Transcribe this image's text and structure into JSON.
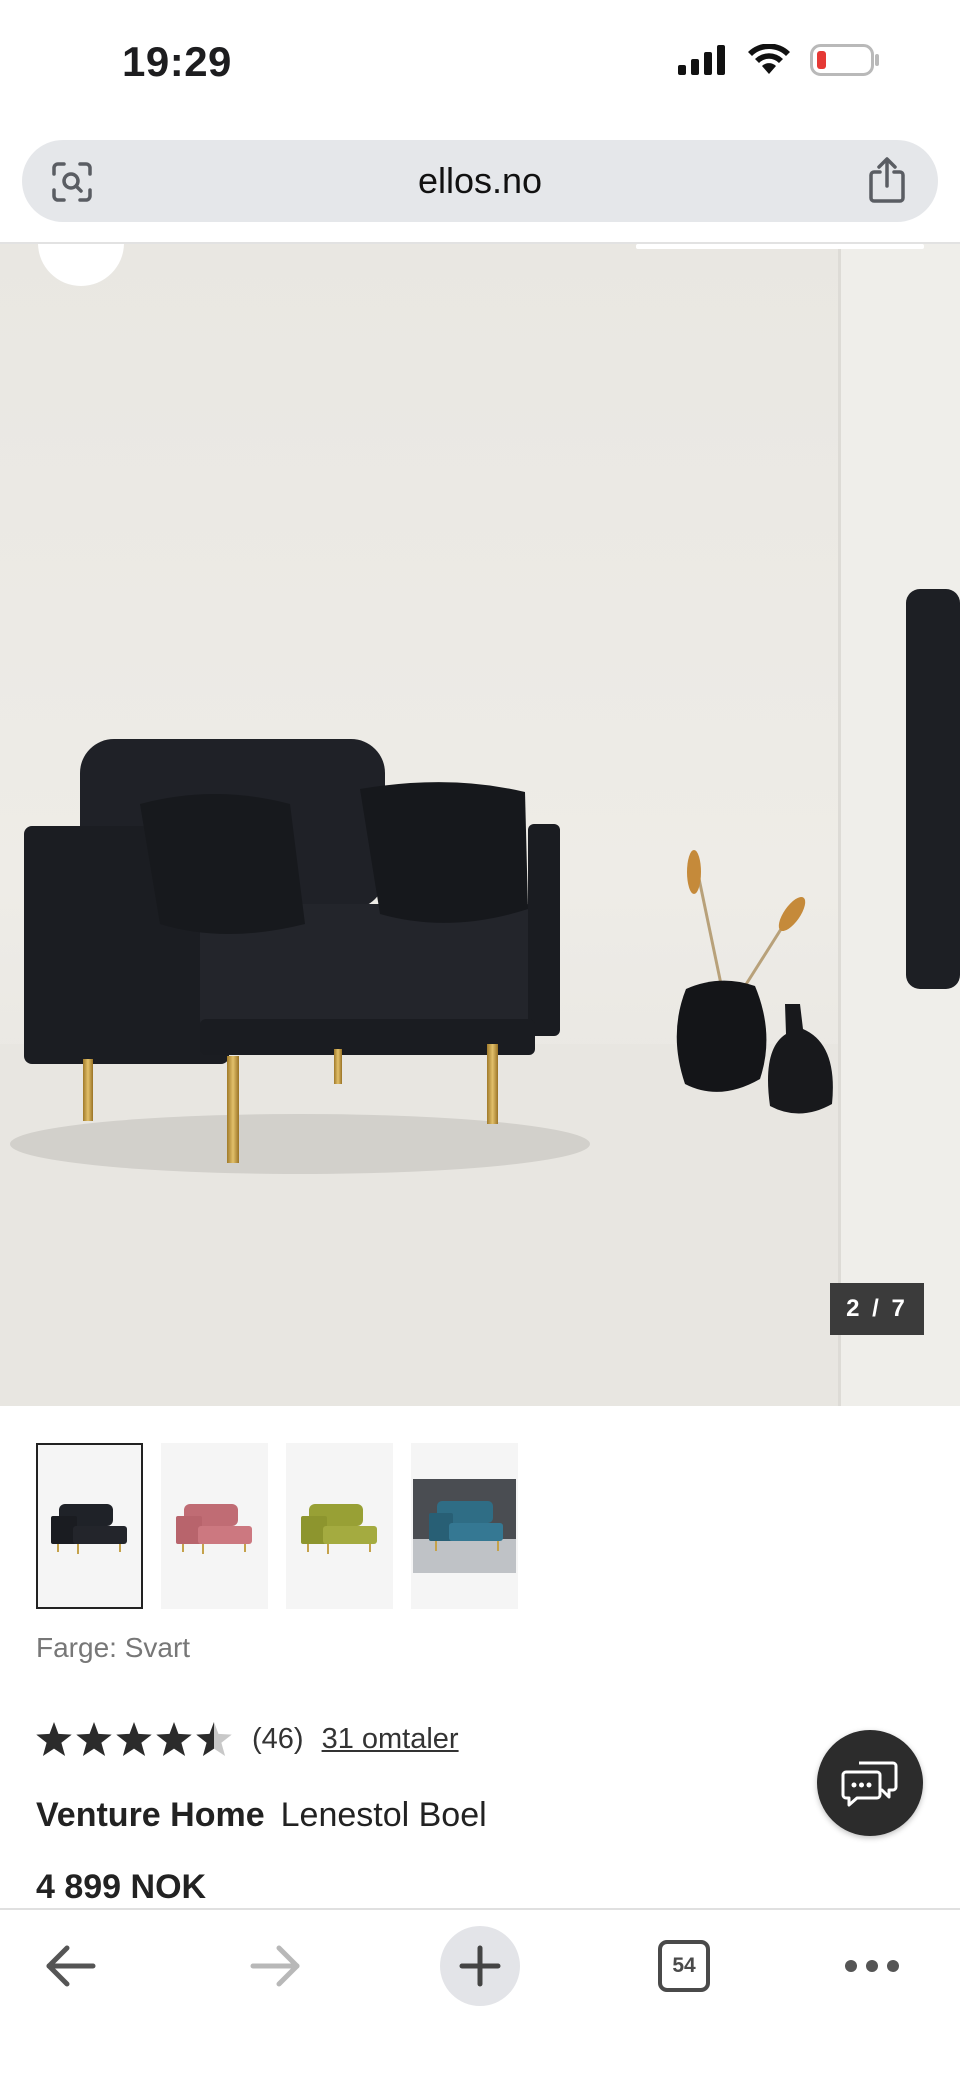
{
  "status_bar": {
    "time": "19:29"
  },
  "browser": {
    "url": "ellos.no"
  },
  "gallery": {
    "counter": "2 / 7"
  },
  "thumbnails": [
    {
      "color_name": "Svart",
      "hex": "#1f2228"
    },
    {
      "color_name": "pink",
      "hex": "#c9747c"
    },
    {
      "color_name": "green",
      "hex": "#9ea33a"
    },
    {
      "color_name": "blue",
      "hex": "#2f6d85"
    }
  ],
  "product": {
    "color_label": "Farge: Svart",
    "rating": 4.5,
    "rating_count": "(46)",
    "reviews_link": "31 omtaler",
    "brand": "Venture Home",
    "name": "Lenestol Boel",
    "price": "4 899 NOK"
  },
  "toolbar": {
    "tab_count": "54"
  },
  "colors": {
    "accent_dark": "#2c2c2c",
    "battery_low": "#e53935"
  }
}
